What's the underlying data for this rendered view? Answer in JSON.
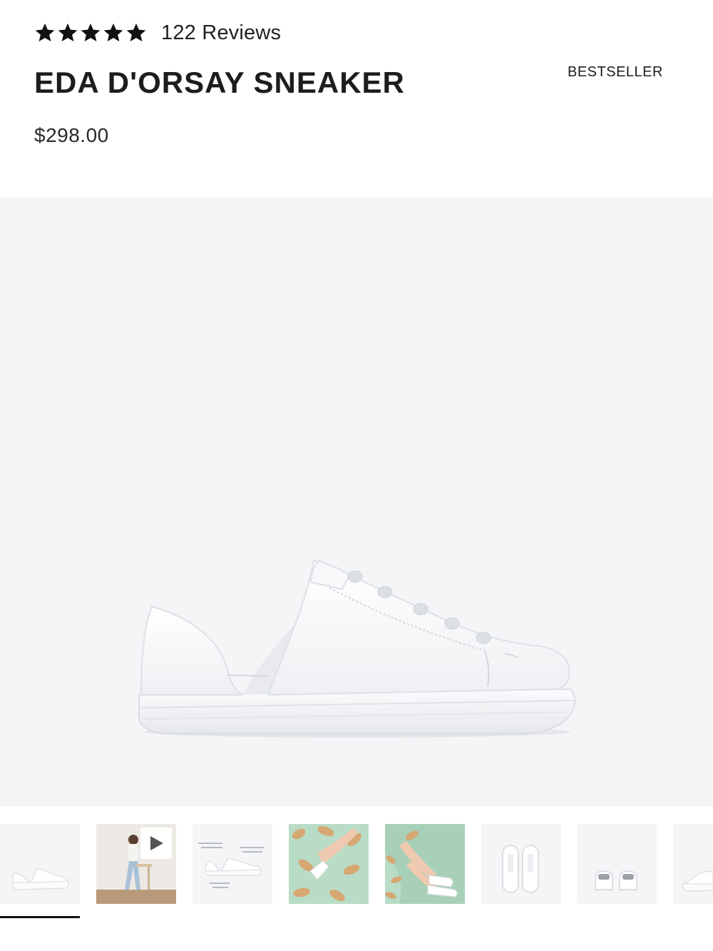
{
  "product": {
    "rating": 5,
    "reviews_label": "122 Reviews",
    "title": "EDA D'ORSAY SNEAKER",
    "badge": "BESTSELLER",
    "price": "$298.00"
  },
  "gallery": {
    "selected_index": 0,
    "thumbnails": [
      {
        "name": "side-view"
      },
      {
        "name": "model-video"
      },
      {
        "name": "feature-diagram"
      },
      {
        "name": "lifestyle-lying"
      },
      {
        "name": "lifestyle-sitting"
      },
      {
        "name": "top-view"
      },
      {
        "name": "back-view"
      },
      {
        "name": "side-view-alt"
      }
    ]
  },
  "colors": {
    "hero_bg": "#f4f5f7",
    "star": "#111111",
    "text": "#1d1d1d",
    "green": "#b9dcc6",
    "tan": "#d6a772"
  }
}
